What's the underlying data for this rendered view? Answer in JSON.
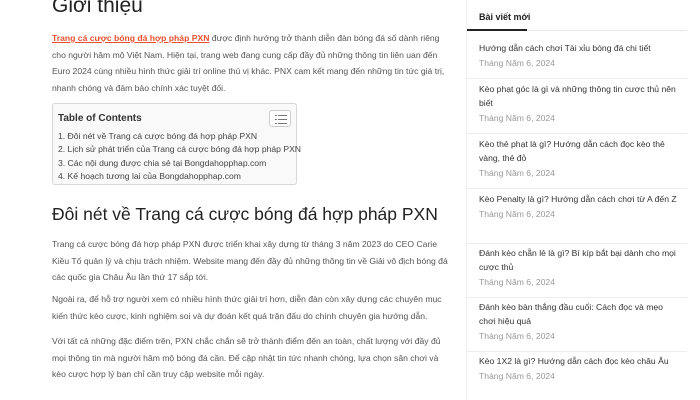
{
  "article": {
    "title": "Giới thiệu",
    "intro_link": "Trang cá cược bóng đá hợp pháp PXN",
    "intro_text": " được định hướng trở thành diễn đàn bóng đá số dành riêng cho người hâm mộ Việt Nam. Hiện tại, trang web đang cung cấp đầy đủ những thông tin liên uan đến Euro 2024 cùng nhiều hình thức giải trí online thú vị khác. PNX cam kết mang đến những tin tức giá trị, nhanh chóng và đảm bảo chính xác tuyệt đối.",
    "toc": {
      "title": "Table of Contents",
      "items": [
        "1. Đôi nét về Trang cá cược bóng đá hợp pháp PXN",
        "2. Lịch sử phát triển của Trang cá cược bóng đá hợp pháp PXN",
        "3. Các nội dung được chia sẻ tại Bongdahopphap.com",
        "4. Kế hoạch tương lai của Bongdahopphap.com"
      ]
    },
    "section_heading": "Đôi nét về Trang cá cược bóng đá hợp pháp PXN",
    "paragraphs": [
      "Trang cá cược bóng đá hợp pháp PXN được triển khai xây dựng từ tháng 3 năm 2023 do CEO Carie Kiều Tố quản lý và chịu trách nhiệm. Website mang đến đầy đủ những thông tin về Giải vô địch bóng đá các quốc gia Châu Âu lần thứ 17 sắp tới.",
      "Ngoài ra, để hỗ trợ người xem có nhiều hình thức giải trí hơn, diễn đàn còn xây dựng các chuyên mục kiến thức kèo cược, kinh nghiệm soi và dự đoán kết quả trận đấu do chính chuyên gia hướng dẫn.",
      "Với tất cả những đặc điểm trên, PXN chắc chắn sẽ trở thành điểm đến an toàn, chất lượng với đầy đủ mọi thông tin mà người hâm mộ bóng đá cần. Để cập nhật tin tức nhanh chóng, lựa chọn sân chơi và kèo cược hợp lý bạn chỉ cần truy cập website mỗi ngày."
    ]
  },
  "sidebar": {
    "title": "Bài viết mới",
    "posts": [
      {
        "title": "Hướng dẫn cách chơi Tài xỉu bóng đá chi tiết",
        "date": "Tháng Năm 6, 2024"
      },
      {
        "title": "Kèo phạt góc là gì và những thông tin cược thủ nên biết",
        "date": "Tháng Năm 6, 2024"
      },
      {
        "title": "Kèo thẻ phạt là gì? Hướng dẫn cách đọc kèo thẻ vàng, thẻ đỏ",
        "date": "Tháng Năm 6, 2024"
      },
      {
        "title": "Kèo Penalty là gì? Hướng dẫn cách chơi từ A đến Z",
        "date": "Tháng Năm 6, 2024"
      },
      {
        "title": "Đánh kèo chẵn lẻ là gì? Bí kíp bắt bại dành cho mọi cược thủ",
        "date": "Tháng Năm 6, 2024"
      },
      {
        "title": "Đánh kèo bàn thắng đầu cuối: Cách đọc và mẹo chơi hiệu quả",
        "date": "Tháng Năm 6, 2024"
      },
      {
        "title": "Kèo 1X2 là gì? Hướng dẫn cách đọc kèo châu Âu",
        "date": "Tháng Năm 6, 2024"
      }
    ]
  }
}
